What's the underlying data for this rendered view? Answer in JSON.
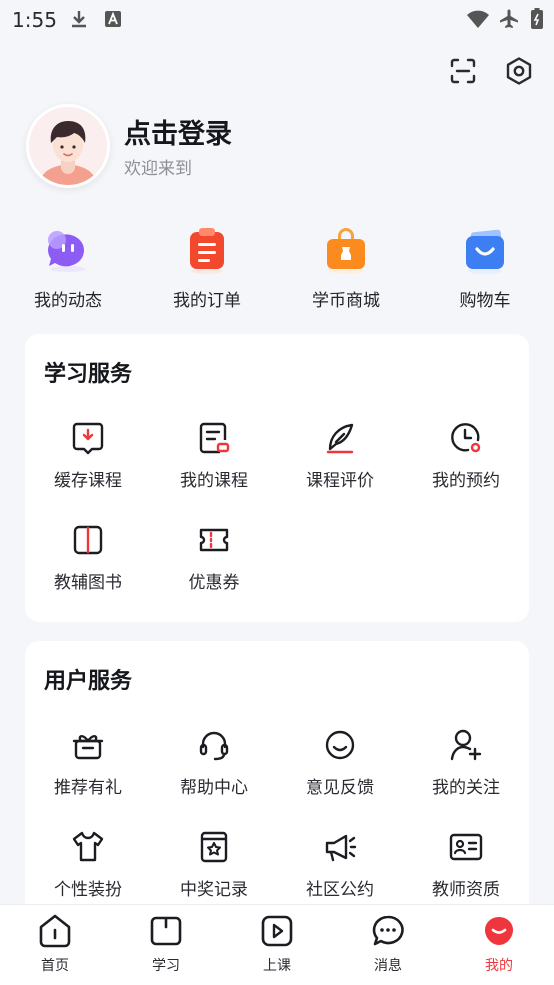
{
  "status_bar": {
    "time": "1:55"
  },
  "profile": {
    "title": "点击登录",
    "subtitle": "欢迎来到"
  },
  "quick_actions": [
    {
      "label": "我的动态",
      "icon": "chat-bubble-icon"
    },
    {
      "label": "我的订单",
      "icon": "order-clipboard-icon"
    },
    {
      "label": "学币商城",
      "icon": "shop-bag-icon"
    },
    {
      "label": "购物车",
      "icon": "shopping-basket-icon"
    }
  ],
  "study_services": {
    "title": "学习服务",
    "items": [
      {
        "label": "缓存课程",
        "icon": "download-icon"
      },
      {
        "label": "我的课程",
        "icon": "course-icon"
      },
      {
        "label": "课程评价",
        "icon": "feather-icon"
      },
      {
        "label": "我的预约",
        "icon": "clock-icon"
      },
      {
        "label": "教辅图书",
        "icon": "book-icon"
      },
      {
        "label": "优惠券",
        "icon": "coupon-icon"
      }
    ]
  },
  "user_services": {
    "title": "用户服务",
    "items": [
      {
        "label": "推荐有礼",
        "icon": "gift-icon"
      },
      {
        "label": "帮助中心",
        "icon": "headset-icon"
      },
      {
        "label": "意见反馈",
        "icon": "smile-icon"
      },
      {
        "label": "我的关注",
        "icon": "user-plus-icon"
      },
      {
        "label": "个性装扮",
        "icon": "tshirt-icon"
      },
      {
        "label": "中奖记录",
        "icon": "prize-icon"
      },
      {
        "label": "社区公约",
        "icon": "megaphone-icon"
      },
      {
        "label": "教师资质",
        "icon": "id-card-icon"
      }
    ]
  },
  "tab_bar": [
    {
      "label": "首页",
      "icon": "home-icon"
    },
    {
      "label": "学习",
      "icon": "study-icon"
    },
    {
      "label": "上课",
      "icon": "play-icon"
    },
    {
      "label": "消息",
      "icon": "message-icon"
    },
    {
      "label": "我的",
      "icon": "me-icon",
      "active": true
    }
  ],
  "colors": {
    "accent": "#f0363d",
    "background": "#f5f6fa"
  }
}
